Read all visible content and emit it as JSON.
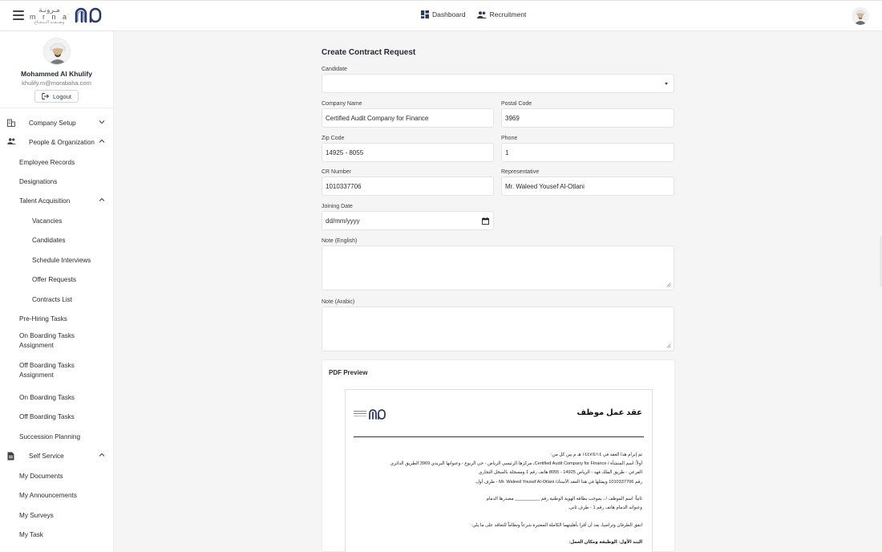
{
  "topbar": {
    "logo_arabic": "مـرونـة",
    "logo_latin": "m r n a",
    "logo_sub": "وصــفــة الــنـجـاح",
    "nav": [
      {
        "label": "Dashboard",
        "icon": "dashboard-icon"
      },
      {
        "label": "Recruitment",
        "icon": "people-icon"
      }
    ]
  },
  "profile": {
    "name": "Mohammed Al Khulify",
    "email": "khulify.m@morabaha.com",
    "logout_label": "Logout"
  },
  "sidebar": {
    "items": [
      {
        "label": "Company Setup",
        "icon": "building-icon",
        "chevron": "down"
      },
      {
        "label": "People & Organization",
        "icon": "people-icon",
        "chevron": "up"
      },
      {
        "label": "Employee Records"
      },
      {
        "label": "Designations"
      },
      {
        "label": "Talent Acquisition",
        "chevron": "up"
      },
      {
        "label": "Vacancies"
      },
      {
        "label": "Candidates"
      },
      {
        "label": "Schedule Interviews"
      },
      {
        "label": "Offer Requests"
      },
      {
        "label": "Contracts List"
      },
      {
        "label": "Pre-Hiring Tasks"
      },
      {
        "label": "On Boarding Tasks Assignment"
      },
      {
        "label": "Off Boarding Tasks Assignment"
      },
      {
        "label": "On Boarding Tasks"
      },
      {
        "label": "Off Boarding Tasks"
      },
      {
        "label": "Succession Planning"
      },
      {
        "label": "Self Service",
        "icon": "document-icon",
        "chevron": "up"
      },
      {
        "label": "My Documents"
      },
      {
        "label": "My Announcements"
      },
      {
        "label": "My Surveys"
      },
      {
        "label": "My Task"
      }
    ]
  },
  "form": {
    "title": "Create Contract Request",
    "candidate": {
      "label": "Candidate",
      "value": ""
    },
    "company_name": {
      "label": "Company Name",
      "value": "Certified Audit Company for Finance"
    },
    "postal_code": {
      "label": "Postal Code",
      "value": "3969"
    },
    "zip_code": {
      "label": "Zip Code",
      "value": "14925 - 8055"
    },
    "phone": {
      "label": "Phone",
      "value": "1"
    },
    "cr_number": {
      "label": "CR Number",
      "value": "1010337706"
    },
    "representative": {
      "label": "Representative",
      "value": "Mr. Waleed Yousef Al-Otlani"
    },
    "joining_date": {
      "label": "Joining Date",
      "placeholder": "dd/mm/yyyy"
    },
    "note_english": {
      "label": "Note (English)",
      "value": ""
    },
    "note_arabic": {
      "label": "Note (Arabic)",
      "value": ""
    }
  },
  "pdf_preview": {
    "title": "PDF Preview",
    "heading": "عقد عمل موظف",
    "lines": [
      "تم إبرام هذا العقد في ١٤٤٧/٤/١٤ هـ م بين كل من:",
      "أولاً: اسم المنشأة / Certified Audit Company for Finance، مركزها الرئيسي الرياض - حي الربوع - وعنوانها البريدي 3969 الطريق الدائري",
      "الفرعي - طريق الملك فهد - الرياض 14925 - 8055 هاتف رقم 1 ومسجلة بالسجل التجاري",
      "رقم 1010337706 ويمثلها في هذا العقد الأستاذ/ Mr. Waleed Yousef Al-Otlani - طرف أول.",
      "ثانياً: اسم الموظف / ، بموجب بطاقة الهوية الوطنية رقم __________ مصدرها الدمام",
      "وعنوانه الدمام هاتف رقم 1 - طرف ثاني.",
      "اتفق الطرفان وتراضيا، بعد أن أقرا بأهليتهما الكاملة المعتبرة شرعاً ونظاماً للتعاقد على ما يلي:",
      "البند الأول: الوظيفة ومكان العمل:"
    ]
  },
  "colors": {
    "accent": "#2b3a6b",
    "background": "#f5f5f5"
  }
}
